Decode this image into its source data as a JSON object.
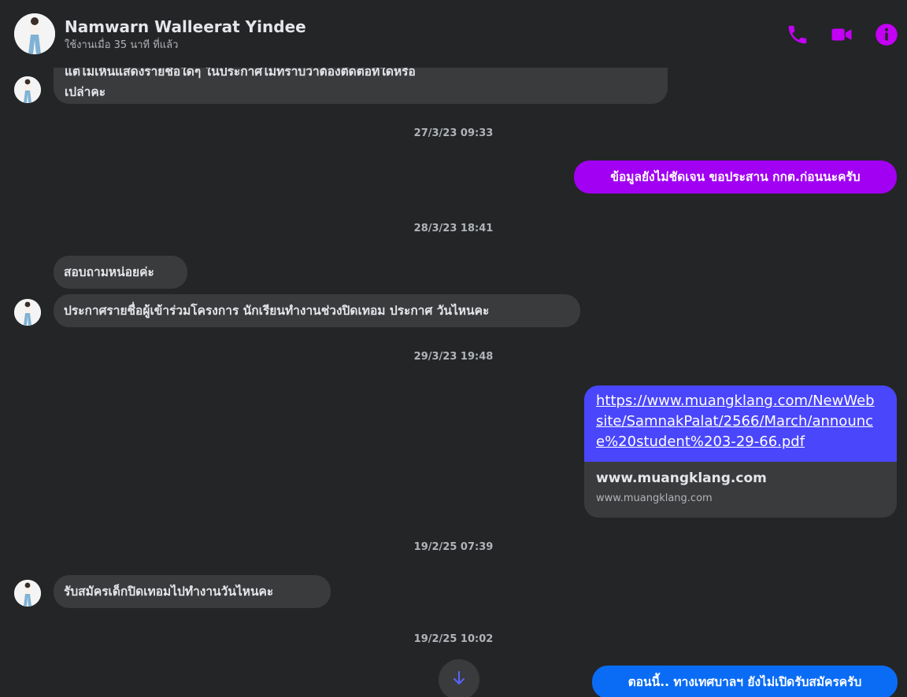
{
  "header": {
    "name": "Namwarn Walleerat Yindee",
    "status": "ใช้งานเมื่อ 35 นาที ที่แล้ว",
    "accent_color": "#c400f5",
    "actions": [
      {
        "icon": "phone-icon"
      },
      {
        "icon": "video-icon"
      },
      {
        "icon": "info-icon"
      }
    ]
  },
  "messages": {
    "partial_text": "แต่ไม่เห็นแสดงรายชื่อใดๆ ในประกาศไม่ทราบว่าต้องติดต่อที่ใดหรือ",
    "first_tail": "เปล่าคะ",
    "ts1": "27/3/23 09:33",
    "out1": "ข้อมูลยังไม่ชัดเจน ขอประสาน กกต.ก่อนนะครับ",
    "ts2": "28/3/23 18:41",
    "in2": "สอบถามหน่อยค่ะ",
    "in3": "ประกาศรายชื่อผู้เข้าร่วมโครงการ นักเรียนทำงานช่วงปิดเทอม ประกาศ วันไหนคะ",
    "ts3": "29/3/23 19:48",
    "link": {
      "line1": "https://www.muangklang.com/NewWeb",
      "line2": "site/SamnakPalat/2566/March/announc",
      "line3": "e%20student%203-29-66.pdf",
      "domain": "www.muangklang.com",
      "domain_sub": "www.muangklang.com"
    },
    "ts4": "19/2/25 07:39",
    "in4": "รับสมัครเด็กปิดเทอมไปทำงานวันไหนคะ",
    "ts5": "19/2/25 10:02",
    "out2": "ตอนนี้.. ทางเทศบาลฯ ยังไม่เปิดรับสมัครครับ"
  },
  "colors": {
    "background": "#242526",
    "incoming_bubble": "#3a3b3c",
    "outgoing_purple": "#a100f2",
    "outgoing_blue": "#0a6cf5",
    "link_bg": "#4a46fb"
  },
  "scroll_button": {
    "icon": "arrow-down-icon"
  }
}
